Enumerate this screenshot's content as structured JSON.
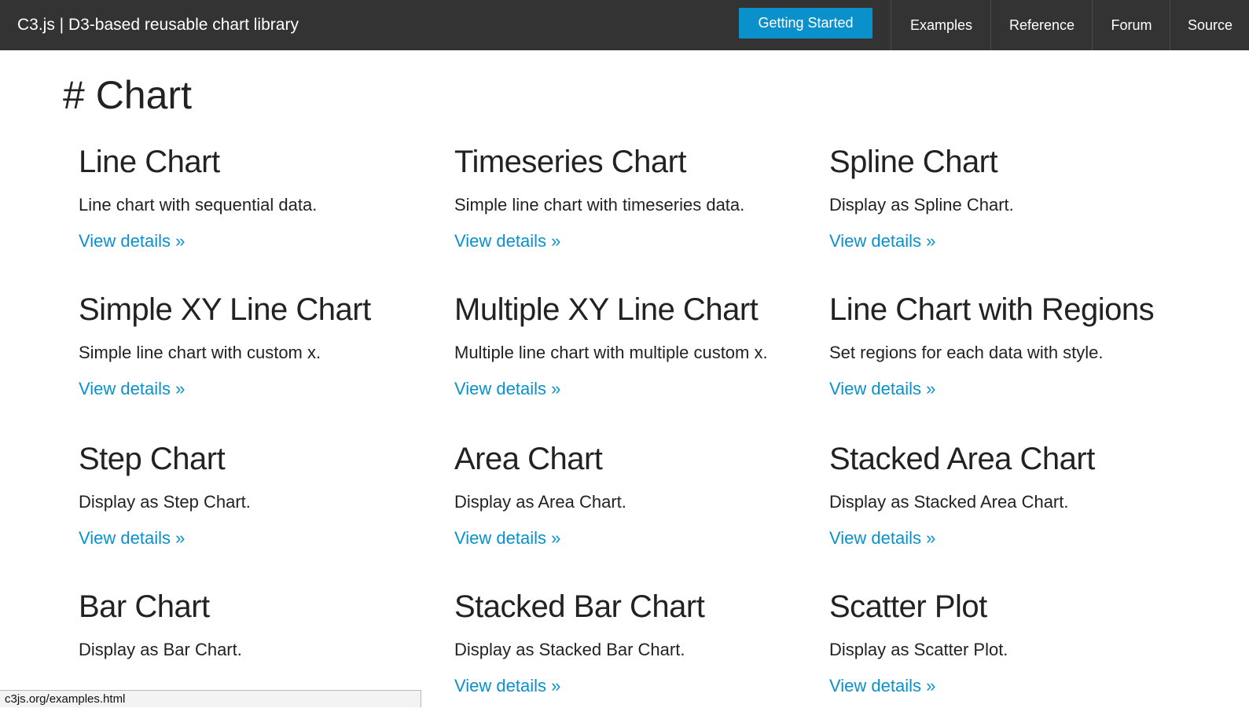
{
  "navbar": {
    "brand": "C3.js | D3-based reusable chart library",
    "getting_started": "Getting Started",
    "links": [
      "Examples",
      "Reference",
      "Forum",
      "Source"
    ]
  },
  "page": {
    "title": "# Chart"
  },
  "cards": [
    {
      "title": "Line Chart",
      "desc": "Line chart with sequential data.",
      "link": "View details »"
    },
    {
      "title": "Timeseries Chart",
      "desc": "Simple line chart with timeseries data.",
      "link": "View details »"
    },
    {
      "title": "Spline Chart",
      "desc": "Display as Spline Chart.",
      "link": "View details »"
    },
    {
      "title": "Simple XY Line Chart",
      "desc": "Simple line chart with custom x.",
      "link": "View details »"
    },
    {
      "title": "Multiple XY Line Chart",
      "desc": "Multiple line chart with multiple custom x.",
      "link": "View details »"
    },
    {
      "title": "Line Chart with Regions",
      "desc": "Set regions for each data with style.",
      "link": "View details »"
    },
    {
      "title": "Step Chart",
      "desc": "Display as Step Chart.",
      "link": "View details »"
    },
    {
      "title": "Area Chart",
      "desc": "Display as Area Chart.",
      "link": "View details »"
    },
    {
      "title": "Stacked Area Chart",
      "desc": "Display as Stacked Area Chart.",
      "link": "View details »"
    },
    {
      "title": "Bar Chart",
      "desc": "Display as Bar Chart.",
      "link": ""
    },
    {
      "title": "Stacked Bar Chart",
      "desc": "Display as Stacked Bar Chart.",
      "link": "View details »"
    },
    {
      "title": "Scatter Plot",
      "desc": "Display as Scatter Plot.",
      "link": "View details »"
    }
  ],
  "statusbar": {
    "url": "c3js.org/examples.html"
  },
  "colors": {
    "navbar_bg": "#333333",
    "accent": "#0a91cc"
  }
}
